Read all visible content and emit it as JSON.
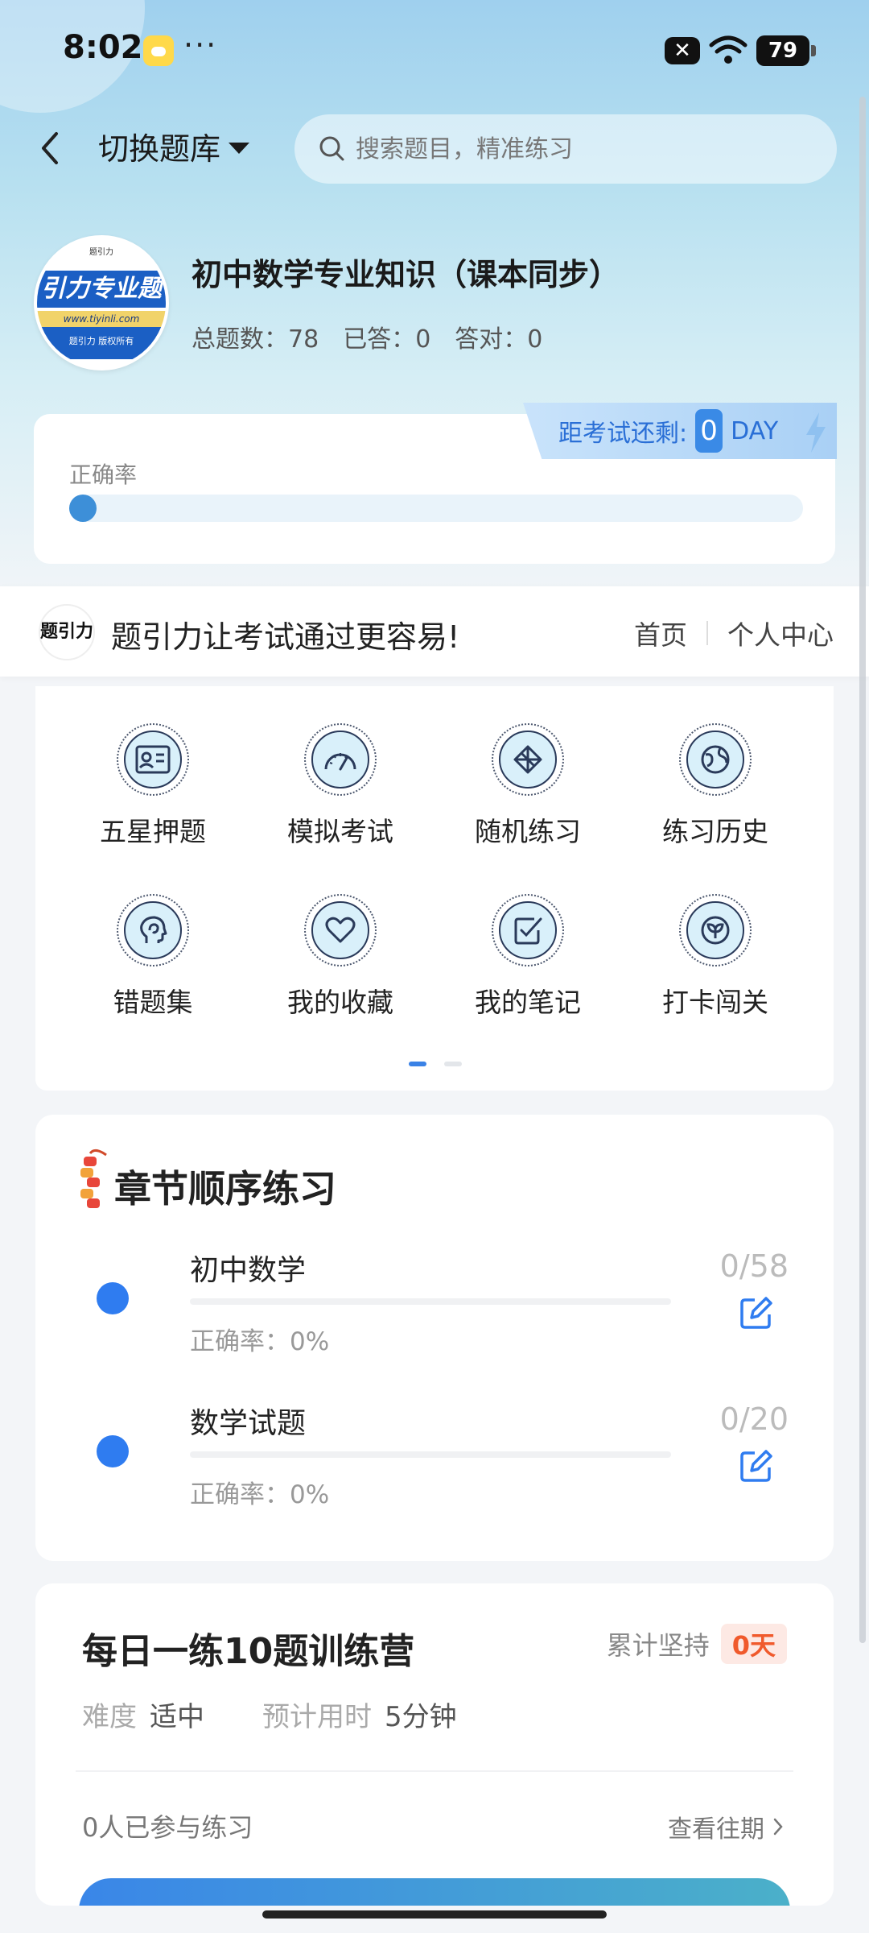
{
  "status_bar": {
    "time": "8:02",
    "more": "···",
    "battery": "79",
    "sim": "✕"
  },
  "nav": {
    "switch_label": "切换题库",
    "search_placeholder": "搜索题目，精准练习"
  },
  "course": {
    "title": "初中数学专业知识（课本同步）",
    "stats": [
      {
        "label": "总题数：",
        "value": "78"
      },
      {
        "label": "已答：",
        "value": "0"
      },
      {
        "label": "答对：",
        "value": "0"
      }
    ],
    "logo": {
      "top": "题引力",
      "band": "引力专业题",
      "url": "www.tiyinli.com",
      "foot": "题引力 版权所有"
    }
  },
  "exam_countdown": {
    "label": "距考试还剩:",
    "value": "0",
    "unit": "DAY"
  },
  "accuracy": {
    "label": "正确率",
    "value": 0
  },
  "slogan": {
    "logo_text": "题引力",
    "text": "题引力让考试通过更容易!",
    "nav": [
      "首页",
      "个人中心"
    ]
  },
  "features": [
    {
      "label": "五星押题",
      "icon": "id-card-icon"
    },
    {
      "label": "模拟考试",
      "icon": "gauge-icon"
    },
    {
      "label": "随机练习",
      "icon": "network-icon"
    },
    {
      "label": "练习历史",
      "icon": "globe-icon"
    },
    {
      "label": "错题集",
      "icon": "head-icon"
    },
    {
      "label": "我的收藏",
      "icon": "heart-icon"
    },
    {
      "label": "我的笔记",
      "icon": "note-check-icon"
    },
    {
      "label": "打卡闯关",
      "icon": "sprout-icon"
    }
  ],
  "feature_pages": {
    "total": 2,
    "active": 0
  },
  "chapters": {
    "title": "章节顺序练习",
    "items": [
      {
        "name": "初中数学",
        "rate": "正确率：0%",
        "count": "0/58"
      },
      {
        "name": "数学试题",
        "rate": "正确率：0%",
        "count": "0/20"
      }
    ]
  },
  "daily": {
    "title": "每日一练10题训练营",
    "persist_label": "累计坚持",
    "persist_days": "0天",
    "difficulty_label": "难度",
    "difficulty": "适中",
    "time_label": "预计用时",
    "time": "5分钟",
    "participants": "0人已参与练习",
    "history": "查看往期"
  },
  "colors": {
    "accent": "#2f7cf0",
    "persist": "#f05a2c"
  }
}
